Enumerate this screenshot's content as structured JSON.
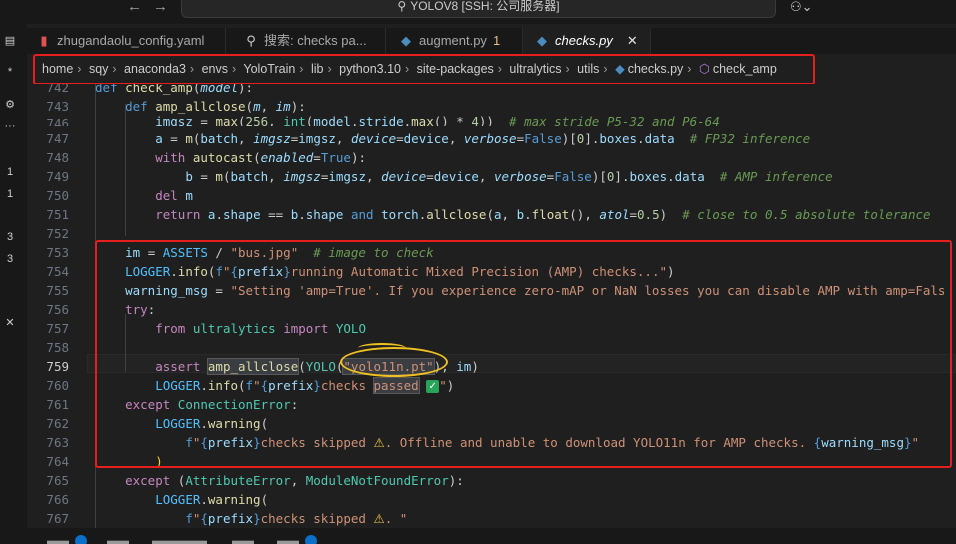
{
  "titlebar": {
    "back_icon": "arrow-left-icon",
    "forward_icon": "arrow-right-icon",
    "command_center": "YOLOV8 [SSH: 公司服务器]",
    "account_icon": "account-icon"
  },
  "activity": {
    "badges": [
      "1",
      "1",
      "3",
      "3"
    ]
  },
  "tabs": [
    {
      "label": "zhugandaolu_config.yaml",
      "icon": "yaml-file-icon",
      "active": false,
      "dirty": ""
    },
    {
      "label": "搜索: checks pa...",
      "icon": "search-icon",
      "active": false,
      "dirty": ""
    },
    {
      "label": "augment.py",
      "icon": "python-file-icon",
      "active": false,
      "dirty": "1"
    },
    {
      "label": "checks.py",
      "icon": "python-file-icon",
      "active": true,
      "dirty": ""
    }
  ],
  "breadcrumb": {
    "items": [
      "home",
      "sqy",
      "anaconda3",
      "envs",
      "YoloTrain",
      "lib",
      "python3.10",
      "site-packages",
      "ultralytics",
      "utils"
    ],
    "file": "checks.py",
    "symbol": "check_amp"
  },
  "editor": {
    "line_numbers": [
      "742",
      "743",
      "746",
      "747",
      "748",
      "749",
      "750",
      "751",
      "752",
      "753",
      "754",
      "755",
      "756",
      "757",
      "758",
      "759",
      "760",
      "761",
      "762",
      "763",
      "764",
      "765",
      "766",
      "767"
    ],
    "current_line": "759",
    "model_arg": "\"yolo11n.pt\""
  },
  "colors": {
    "annotation_red": "#e51e1e",
    "annotation_yellow": "#f0c020",
    "editor_bg": "#1f1f1f"
  }
}
